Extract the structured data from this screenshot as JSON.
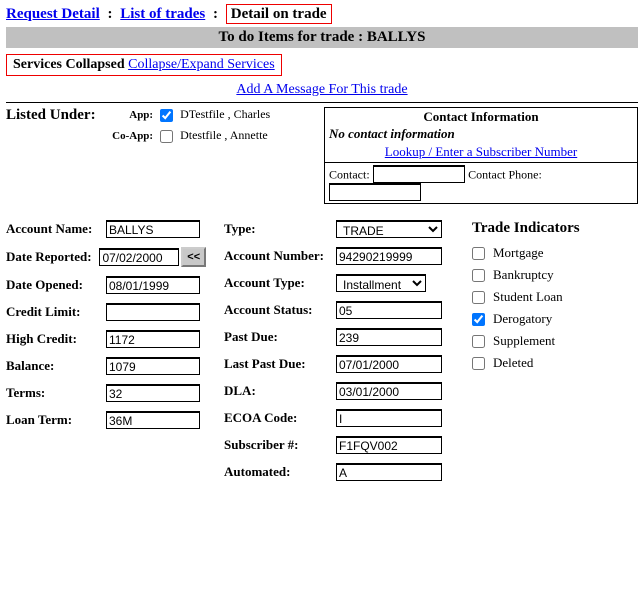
{
  "breadcrumb": {
    "request_detail": "Request Detail",
    "list_of_trades": "List of trades",
    "detail_on_trade": "Detail on trade"
  },
  "graybar": "To do Items for trade :  BALLYS",
  "services": {
    "label": "Services Collapsed",
    "toggle": "Collapse/Expand Services"
  },
  "add_msg": "Add A Message For This trade",
  "listed_under": {
    "title": "Listed Under:",
    "app_label": "App:",
    "coapp_label": "Co-App:",
    "app_checked": true,
    "coapp_checked": false,
    "app_name": "DTestfile , Charles",
    "coapp_name": "Dtestfile , Annette"
  },
  "contact": {
    "title": "Contact Information",
    "none": "No contact information",
    "lookup": "Lookup / Enter a Subscriber Number",
    "contact_label": "Contact:",
    "phone_label": "Contact Phone:",
    "contact_val": "",
    "phone_val": ""
  },
  "left": {
    "account_name": {
      "label": "Account Name:",
      "value": "BALLYS"
    },
    "date_reported": {
      "label": "Date Reported:",
      "value": "07/02/2000"
    },
    "prev_btn": "<<",
    "date_opened": {
      "label": "Date Opened:",
      "value": "08/01/1999"
    },
    "credit_limit": {
      "label": "Credit Limit:",
      "value": ""
    },
    "high_credit": {
      "label": "High Credit:",
      "value": "1172"
    },
    "balance": {
      "label": "Balance:",
      "value": "1079"
    },
    "terms": {
      "label": "Terms:",
      "value": "32"
    },
    "loan_term": {
      "label": "Loan Term:",
      "value": "36M"
    }
  },
  "mid": {
    "type": {
      "label": "Type:",
      "value": "TRADE"
    },
    "account_number": {
      "label": "Account Number:",
      "value": "94290219999"
    },
    "account_type": {
      "label": "Account Type:",
      "value": "Installment"
    },
    "account_status": {
      "label": "Account Status:",
      "value": "05"
    },
    "past_due": {
      "label": "Past Due:",
      "value": "239"
    },
    "last_past_due": {
      "label": "Last Past Due:",
      "value": "07/01/2000"
    },
    "dla": {
      "label": "DLA:",
      "value": "03/01/2000"
    },
    "ecoa": {
      "label": "ECOA Code:",
      "value": "I"
    },
    "subscriber": {
      "label": "Subscriber #:",
      "value": "F1FQV002"
    },
    "automated": {
      "label": "Automated:",
      "value": "A"
    }
  },
  "indicators": {
    "title": "Trade Indicators",
    "items": [
      {
        "label": "Mortgage",
        "checked": false
      },
      {
        "label": "Bankruptcy",
        "checked": false
      },
      {
        "label": "Student Loan",
        "checked": false
      },
      {
        "label": "Derogatory",
        "checked": true
      },
      {
        "label": "Supplement",
        "checked": false
      },
      {
        "label": "Deleted",
        "checked": false
      }
    ]
  }
}
